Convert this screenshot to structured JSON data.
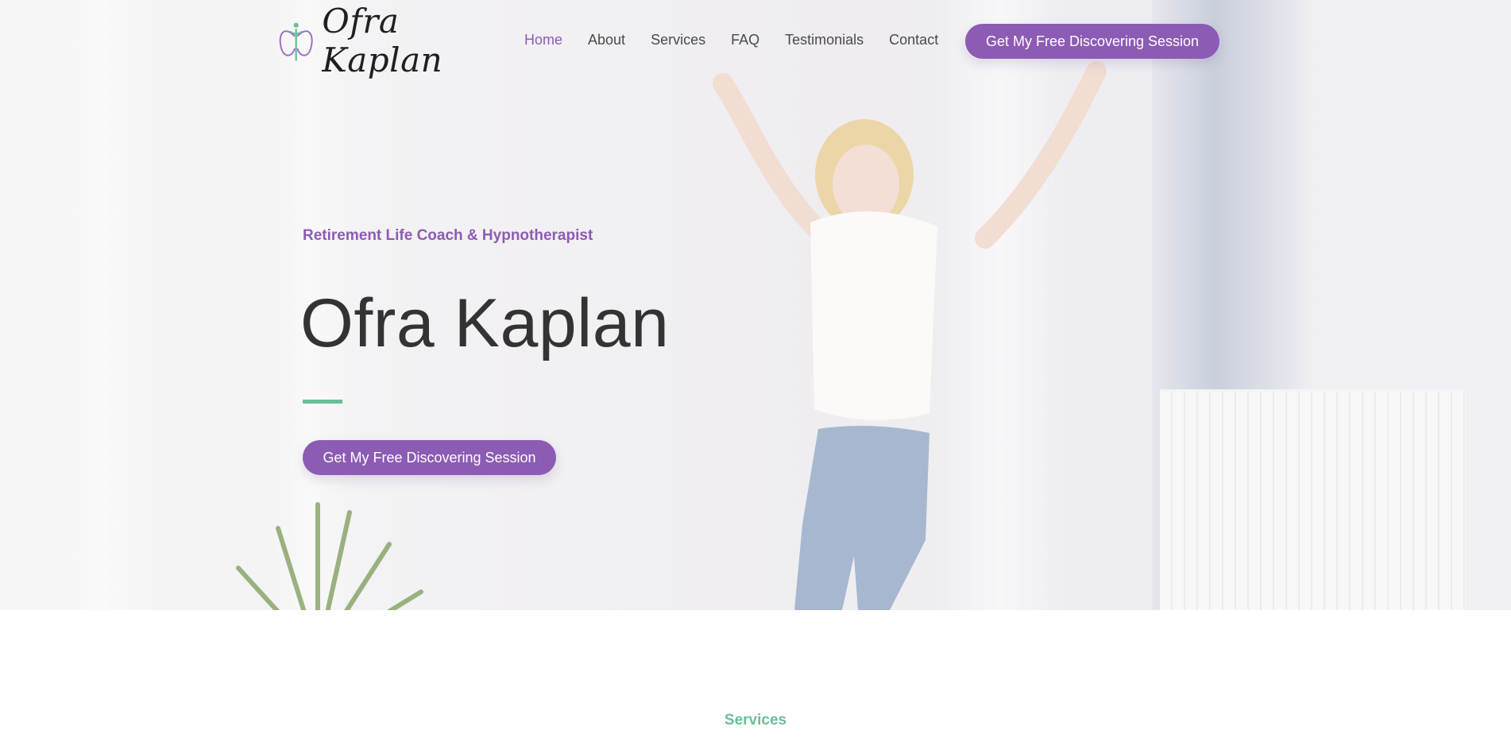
{
  "header": {
    "logo_text": "Ofra Kaplan",
    "nav": [
      "Home",
      "About",
      "Services",
      "FAQ",
      "Testimonials",
      "Contact"
    ],
    "active_nav": "Home",
    "cta_label": "Get My Free Discovering Session"
  },
  "hero": {
    "tagline": "Retirement Life Coach & Hypnotherapist",
    "title": "Ofra Kaplan",
    "cta_label": "Get My Free Discovering Session"
  },
  "next_section": {
    "label": "Services"
  },
  "colors": {
    "accent_purple": "#8c5bb3",
    "accent_green": "#6bbf96",
    "text_dark": "#333333"
  },
  "icons": [
    "butterfly-logo-icon"
  ]
}
